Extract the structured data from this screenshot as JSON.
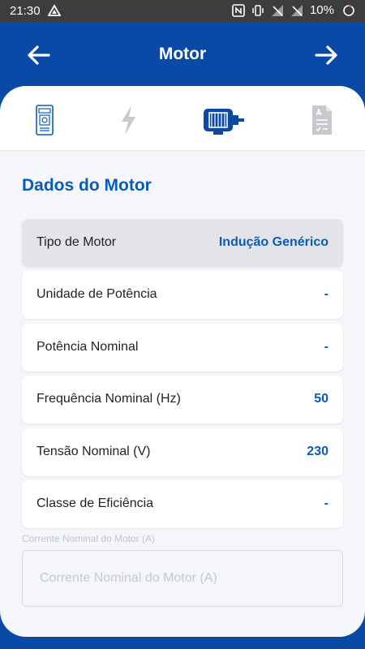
{
  "status_bar": {
    "time": "21:30",
    "battery": "10%",
    "icons": [
      "drive-icon",
      "nfc-icon",
      "vibrate-icon",
      "no-signal-icon",
      "no-signal-icon",
      "battery-icon"
    ]
  },
  "header": {
    "title": "Motor",
    "back_icon": "arrow-left-icon",
    "forward_icon": "arrow-right-icon"
  },
  "tabs": [
    {
      "icon": "drive-device-icon",
      "active": false
    },
    {
      "icon": "lightning-icon",
      "active": false
    },
    {
      "icon": "motor-icon",
      "active": true
    },
    {
      "icon": "checklist-icon",
      "active": false
    }
  ],
  "section": {
    "title": "Dados do Motor"
  },
  "rows": [
    {
      "label": "Tipo de Motor",
      "value": "Indução Genérico"
    },
    {
      "label": "Unidade de Potência",
      "value": "-"
    },
    {
      "label": "Potência Nominal",
      "value": "-"
    },
    {
      "label": "Frequência Nominal (Hz)",
      "value": "50"
    },
    {
      "label": "Tensão Nominal (V)",
      "value": "230"
    },
    {
      "label": "Classe de Eficiência",
      "value": "-"
    }
  ],
  "current_field": {
    "caption": "Corrente Nominal do Motor (A)",
    "placeholder": "Corrente Nominal do Motor (A)",
    "value": ""
  },
  "colors": {
    "primary": "#0a4aa6",
    "accent_text": "#0a5bb5",
    "inactive_icon": "#c7c9ce",
    "background": "#f5f6fa"
  }
}
